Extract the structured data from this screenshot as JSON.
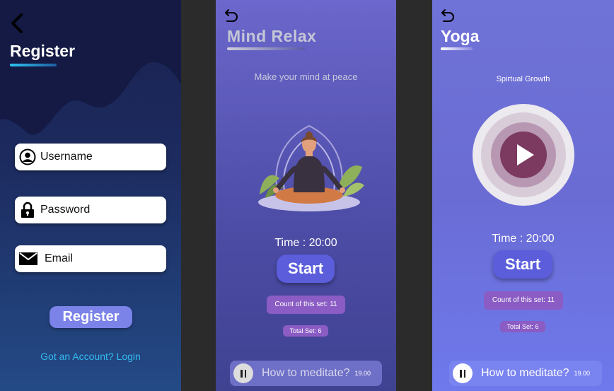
{
  "register_screen": {
    "title": "Register",
    "fields": [
      {
        "icon": "user-icon",
        "label": "Username"
      },
      {
        "icon": "lock-icon",
        "label": "Password"
      },
      {
        "icon": "mail-icon",
        "label": "Email"
      }
    ],
    "register_button": "Register",
    "login_link": "Got an Account? Login",
    "colors": {
      "accent": "#33bbee",
      "button": "#7b83e8"
    }
  },
  "mind_relax_screen": {
    "title": "Mind Relax",
    "subtitle": "Make your mind at peace",
    "time": "Time : 20:00",
    "start_button": "Start",
    "count": "Count of this set: 11",
    "total": "Total Set: 6",
    "how_to": {
      "label": "How to meditate?",
      "duration": "19.00"
    }
  },
  "yoga_screen": {
    "title": "Yoga",
    "subtitle": "Spirtual Growth",
    "time": "Time : 20:00",
    "start_button": "Start",
    "count": "Count of this set: 11",
    "total": "Total Set: 6",
    "how_to": {
      "label": "How to meditate?",
      "duration": "19.00"
    }
  }
}
